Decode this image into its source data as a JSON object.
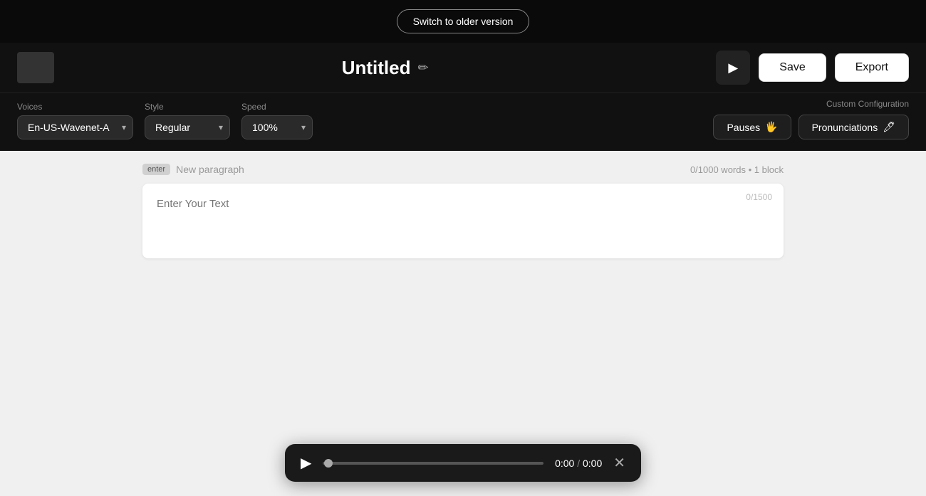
{
  "topbar": {
    "switch_label": "Switch to older version"
  },
  "header": {
    "title": "Untitled",
    "edit_icon": "✏",
    "play_icon": "▶",
    "save_label": "Save",
    "export_label": "Export"
  },
  "controls": {
    "voices_label": "Voices",
    "voices_value": "En-US-Wavenet-A",
    "style_label": "Style",
    "style_value": "Regular",
    "speed_label": "Speed",
    "speed_value": "100%",
    "custom_config_label": "Custom Configuration",
    "pauses_label": "Pauses",
    "pauses_icon": "✋",
    "pronunciations_label": "Pronunciations",
    "pronunciations_icon": "✏"
  },
  "editor": {
    "enter_badge": "enter",
    "new_paragraph_placeholder": "New paragraph",
    "word_count": "0/1000 words",
    "block_count": "1 block",
    "char_count": "0/1500",
    "text_placeholder": "Enter Your Text"
  },
  "player": {
    "play_icon": "▶",
    "current_time": "0:00",
    "separator": "/",
    "total_time": "0:00",
    "close_icon": "✕"
  },
  "colors": {
    "bg_dark": "#0a0a0a",
    "bg_header": "#111111",
    "bg_main": "#f0f0f0",
    "text_white": "#ffffff",
    "text_muted": "#888888"
  }
}
